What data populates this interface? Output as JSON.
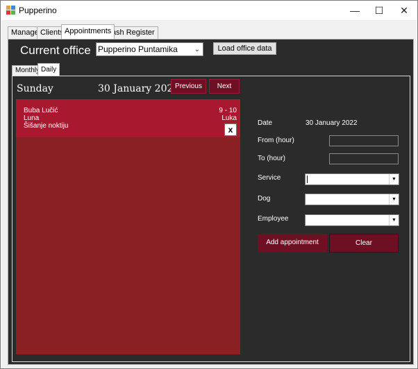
{
  "window": {
    "title": "Pupperino",
    "controls": {
      "minimize": "—",
      "maximize": "☐",
      "close": "✕"
    }
  },
  "main_tabs": [
    "Manager",
    "Clients",
    "Appointments",
    "Cash Register"
  ],
  "active_main_tab": "Appointments",
  "office": {
    "label": "Current office",
    "selected": "Pupperino Puntamika",
    "load_button": "Load office data"
  },
  "view_tabs": [
    "Monthly",
    "Daily"
  ],
  "active_view_tab": "Daily",
  "day": {
    "name": "Sunday",
    "date": "30 January 2022",
    "prev_button": "Previous",
    "next_button": "Next"
  },
  "appointments": [
    {
      "client": "Buba Lučić",
      "time": "9 - 10",
      "dog": "Luna",
      "employee": "Luka",
      "service": "Šišanje noktiju",
      "delete": "x"
    }
  ],
  "form": {
    "date_label": "Date",
    "date_value": "30 January 2022",
    "from_label": "From (hour)",
    "from_value": "",
    "to_label": "To (hour)",
    "to_value": "",
    "service_label": "Service",
    "service_value": "",
    "dog_label": "Dog",
    "dog_value": "",
    "employee_label": "Employee",
    "employee_value": "",
    "add_button": "Add appointment",
    "clear_button": "Clear"
  },
  "colors": {
    "dark_panel": "#2b2b2b",
    "calendar_bg": "#8a1f24",
    "appointment_bg": "#a8182f",
    "button_maroon": "#6e1023"
  }
}
